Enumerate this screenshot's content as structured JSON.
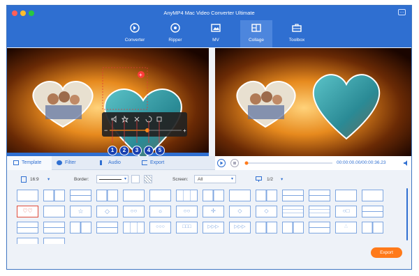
{
  "app": {
    "title": "AnyMP4 Mac Video Converter Ultimate"
  },
  "nav": [
    {
      "label": "Converter",
      "icon": "converter-icon"
    },
    {
      "label": "Ripper",
      "icon": "ripper-icon"
    },
    {
      "label": "MV",
      "icon": "mv-icon"
    },
    {
      "label": "Collage",
      "icon": "collage-icon"
    },
    {
      "label": "Toolbox",
      "icon": "toolbox-icon"
    }
  ],
  "edit_controls": {
    "badges": [
      "1",
      "2",
      "3",
      "4",
      "5"
    ]
  },
  "tabs": [
    {
      "label": "Template",
      "icon": "template-icon"
    },
    {
      "label": "Filter",
      "icon": "filter-icon"
    },
    {
      "label": "Audio",
      "icon": "audio-icon"
    },
    {
      "label": "Export",
      "icon": "export-icon"
    }
  ],
  "player": {
    "time": "00:00:00.00/00:00:36.23"
  },
  "toolbar": {
    "ratio": "16:9",
    "border_label": "Border:",
    "screen_label": "Screen:",
    "screen_value": "All",
    "page": "1/2"
  },
  "export_label": "Export",
  "colors": {
    "accent": "#2f6fd1",
    "export": "#ff7a1a",
    "selected_template": "#e04b3a"
  }
}
